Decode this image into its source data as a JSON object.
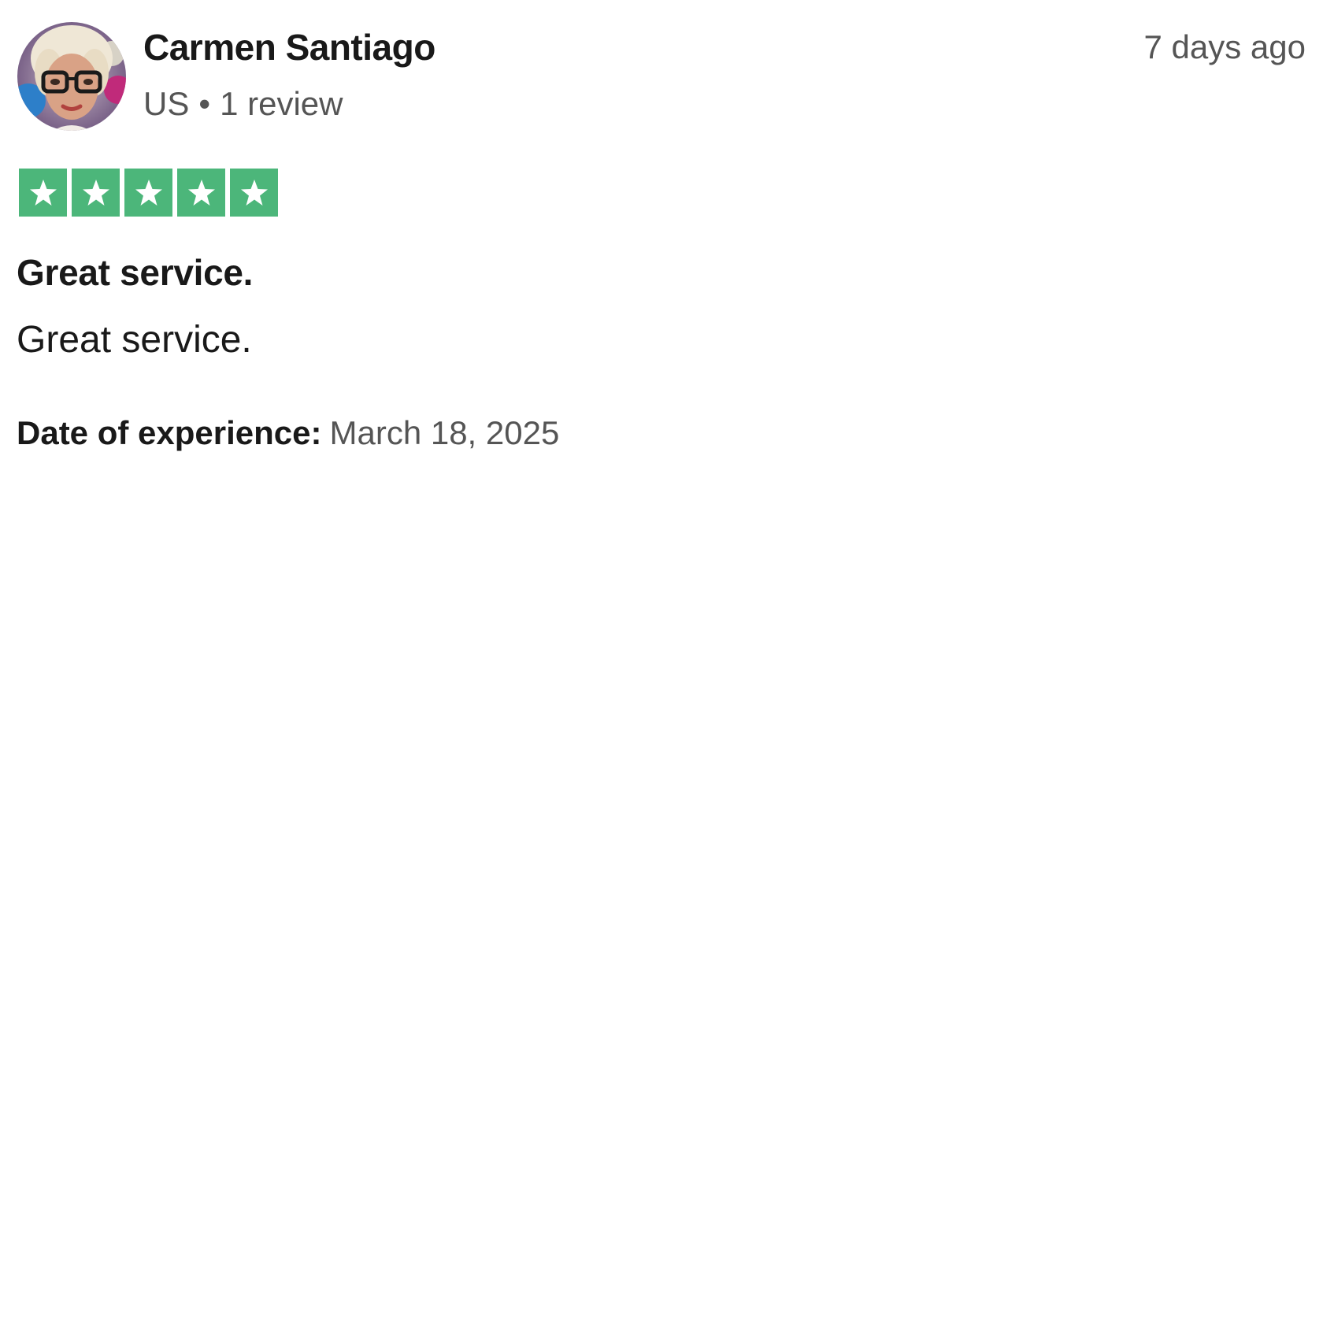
{
  "review": {
    "author": {
      "name": "Carmen Santiago",
      "country": "US",
      "separator": "•",
      "review_count": "1 review",
      "avatar_icon": "user-avatar-photo"
    },
    "time_ago": "7 days ago",
    "rating": {
      "value": 5,
      "max": 5,
      "star_color": "#4cb67a",
      "icon": "star-icon"
    },
    "title": "Great service.",
    "body": "Great service.",
    "date_of_experience": {
      "label": "Date of experience:",
      "value": "March 18, 2025"
    }
  }
}
